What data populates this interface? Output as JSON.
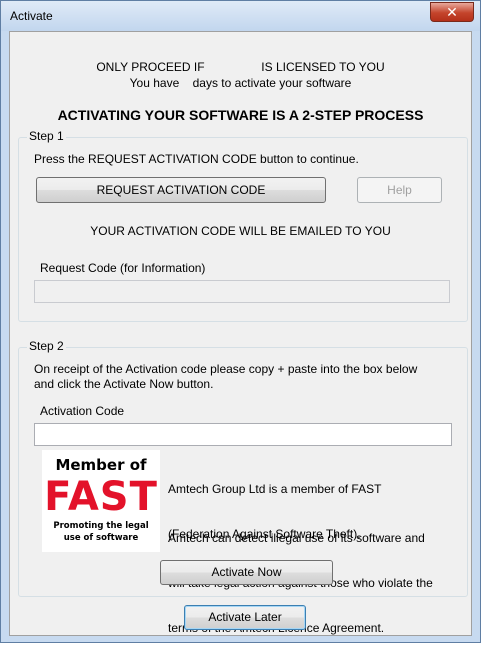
{
  "window": {
    "title": "Activate",
    "close_glyph": "✕"
  },
  "header": {
    "line1": "ONLY PROCEED IF                 IS LICENSED TO YOU",
    "line2": "You have    days to activate your software",
    "process_heading": "ACTIVATING YOUR SOFTWARE IS A 2-STEP PROCESS"
  },
  "step1": {
    "legend": "Step 1",
    "instruction": "Press the REQUEST ACTIVATION CODE button to continue.",
    "request_button": "REQUEST ACTIVATION CODE",
    "help_button": "Help",
    "email_notice": "YOUR ACTIVATION CODE WILL BE EMAILED TO YOU",
    "request_code_label": "Request Code (for Information)",
    "request_code_value": ""
  },
  "step2": {
    "legend": "Step 2",
    "instruction_line1": "On receipt of the Activation code please copy + paste into the box below",
    "instruction_line2": "and click the Activate Now button.",
    "activation_code_label": "Activation Code",
    "activation_code_value": "",
    "fast_info_line1": "Amtech Group Ltd is a member of FAST",
    "fast_info_line2": "(Federation Against Software Theft).",
    "legal_line1": "Amtech can detect illegal use of its software and",
    "legal_line2": "will take legal action against those who violate the",
    "legal_line3": "terms of the Amtech Licence Agreement.",
    "activate_now_button": "Activate Now"
  },
  "logo": {
    "top": "Member of",
    "brand": "FAST",
    "bottom_line1": "Promoting the legal",
    "bottom_line2": "use of software",
    "brand_color": "#e3122a"
  },
  "footer": {
    "activate_later_button": "Activate Later"
  }
}
